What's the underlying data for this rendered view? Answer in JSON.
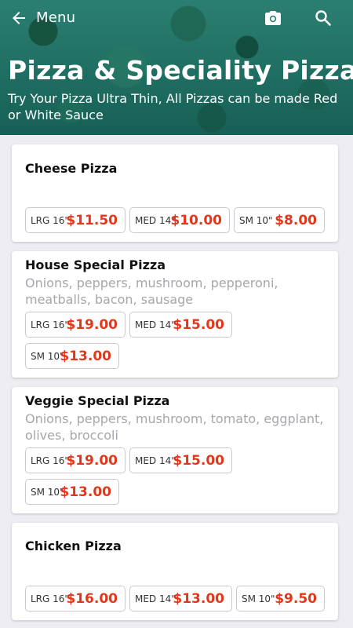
{
  "header": {
    "back_label": "Menu",
    "title": "Pizza & Speciality Pizza",
    "subtitle": "Try Your Pizza Ultra Thin, All Pizzas can be made Red or White Sauce",
    "icons": [
      "arrow-left-icon",
      "camera-icon",
      "search-icon"
    ]
  },
  "colors": {
    "header_teal": "#1f6e62",
    "price_red": "#e2371c",
    "background": "#eeedf2"
  },
  "items": [
    {
      "name": "Cheese Pizza",
      "description": "",
      "prices": [
        {
          "size": "LRG 16\"",
          "price": "$11.50"
        },
        {
          "size": "MED 14\"",
          "price": "$10.00"
        },
        {
          "size": "SM 10\"",
          "price": "$8.00"
        }
      ]
    },
    {
      "name": "House Special Pizza",
      "description": "Onions, peppers, mushroom, pepperoni, meatballs, bacon, sausage",
      "prices": [
        {
          "size": "LRG 16\"",
          "price": "$19.00"
        },
        {
          "size": "MED 14\"",
          "price": "$15.00"
        },
        {
          "size": "SM 10\"",
          "price": "$13.00"
        }
      ]
    },
    {
      "name": "Veggie Special Pizza",
      "description": "Onions, peppers, mushroom, tomato, eggplant, olives, broccoli",
      "prices": [
        {
          "size": "LRG 16\"",
          "price": "$19.00"
        },
        {
          "size": "MED 14\"",
          "price": "$15.00"
        },
        {
          "size": "SM 10\"",
          "price": "$13.00"
        }
      ]
    },
    {
      "name": "Chicken Pizza",
      "description": "",
      "prices": [
        {
          "size": "LRG 16\"",
          "price": "$16.00"
        },
        {
          "size": "MED 14\"",
          "price": "$13.00"
        },
        {
          "size": "SM 10\"",
          "price": "$9.50"
        }
      ]
    }
  ]
}
